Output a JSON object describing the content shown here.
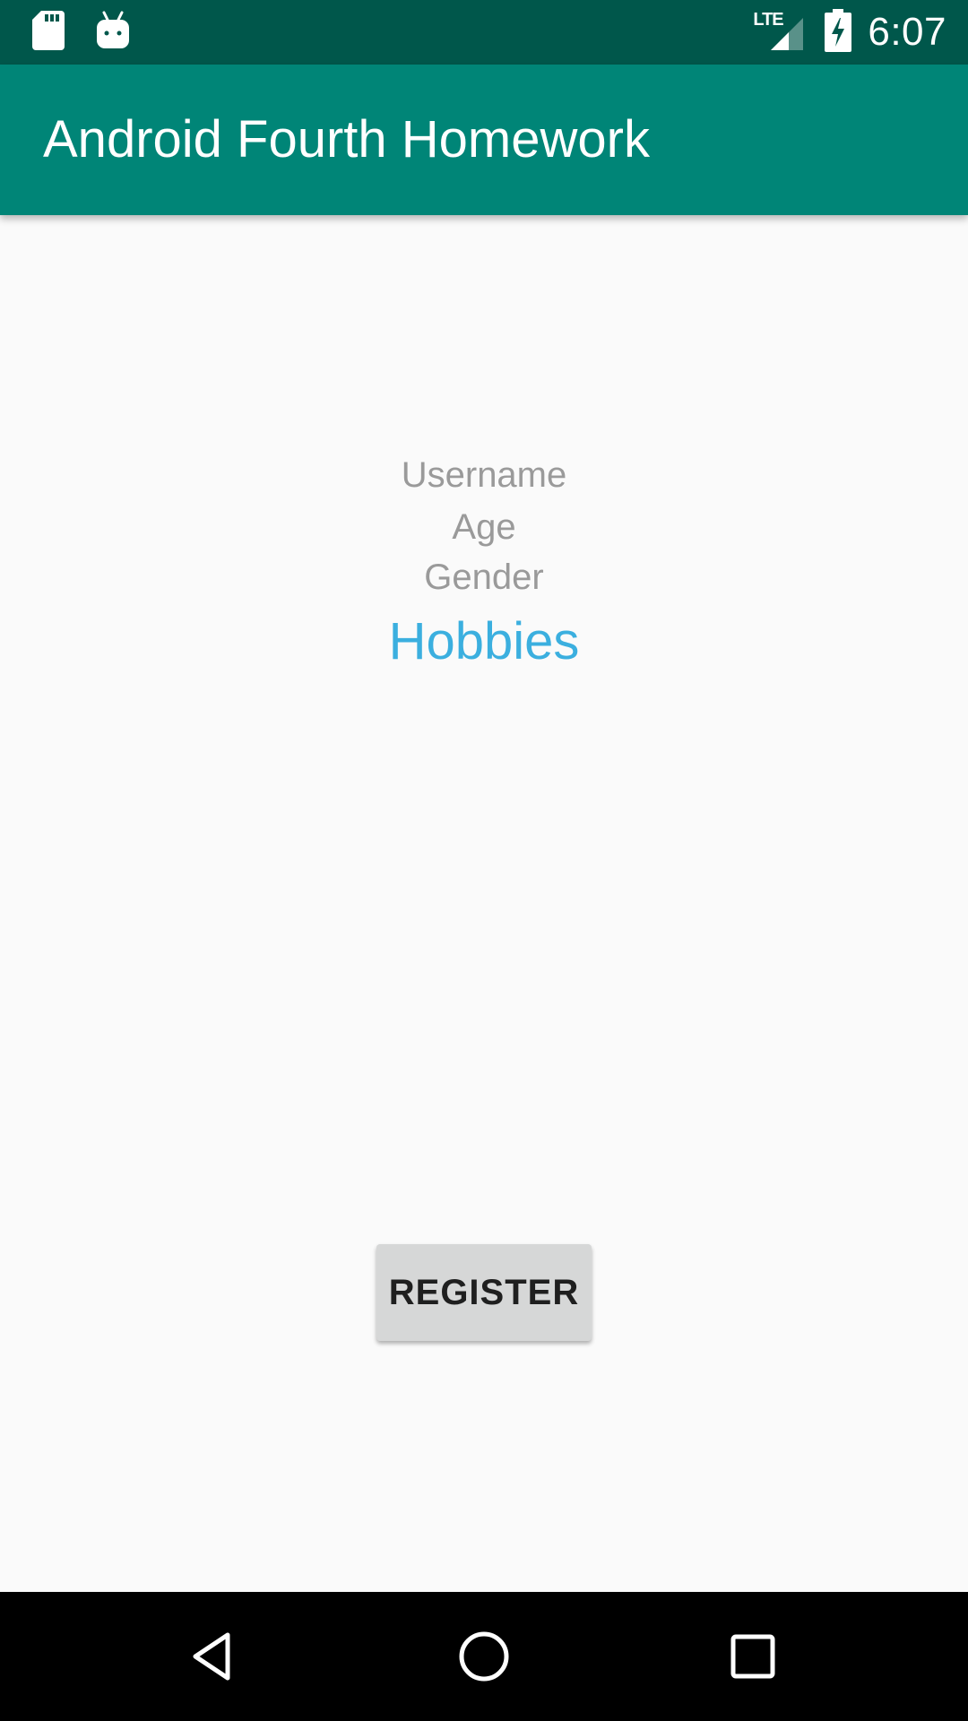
{
  "status_bar": {
    "time": "6:07",
    "network_label": "LTE",
    "icons": [
      "sd-card-icon",
      "android-icon",
      "lte-signal-icon",
      "battery-charging-icon"
    ]
  },
  "app_bar": {
    "title": "Android Fourth Homework"
  },
  "form": {
    "labels": {
      "username": "Username",
      "age": "Age",
      "gender": "Gender",
      "hobbies": "Hobbies"
    },
    "register_label": "REGISTER"
  },
  "nav_bar": {
    "icons": [
      "back-icon",
      "home-icon",
      "recents-icon"
    ]
  },
  "colors": {
    "status_bar": "#00574b",
    "app_bar": "#008577",
    "background": "#fafafa",
    "label_gray": "#9a9a9a",
    "highlight_blue": "#3bafdf",
    "button_bg": "#d6d7d7"
  }
}
